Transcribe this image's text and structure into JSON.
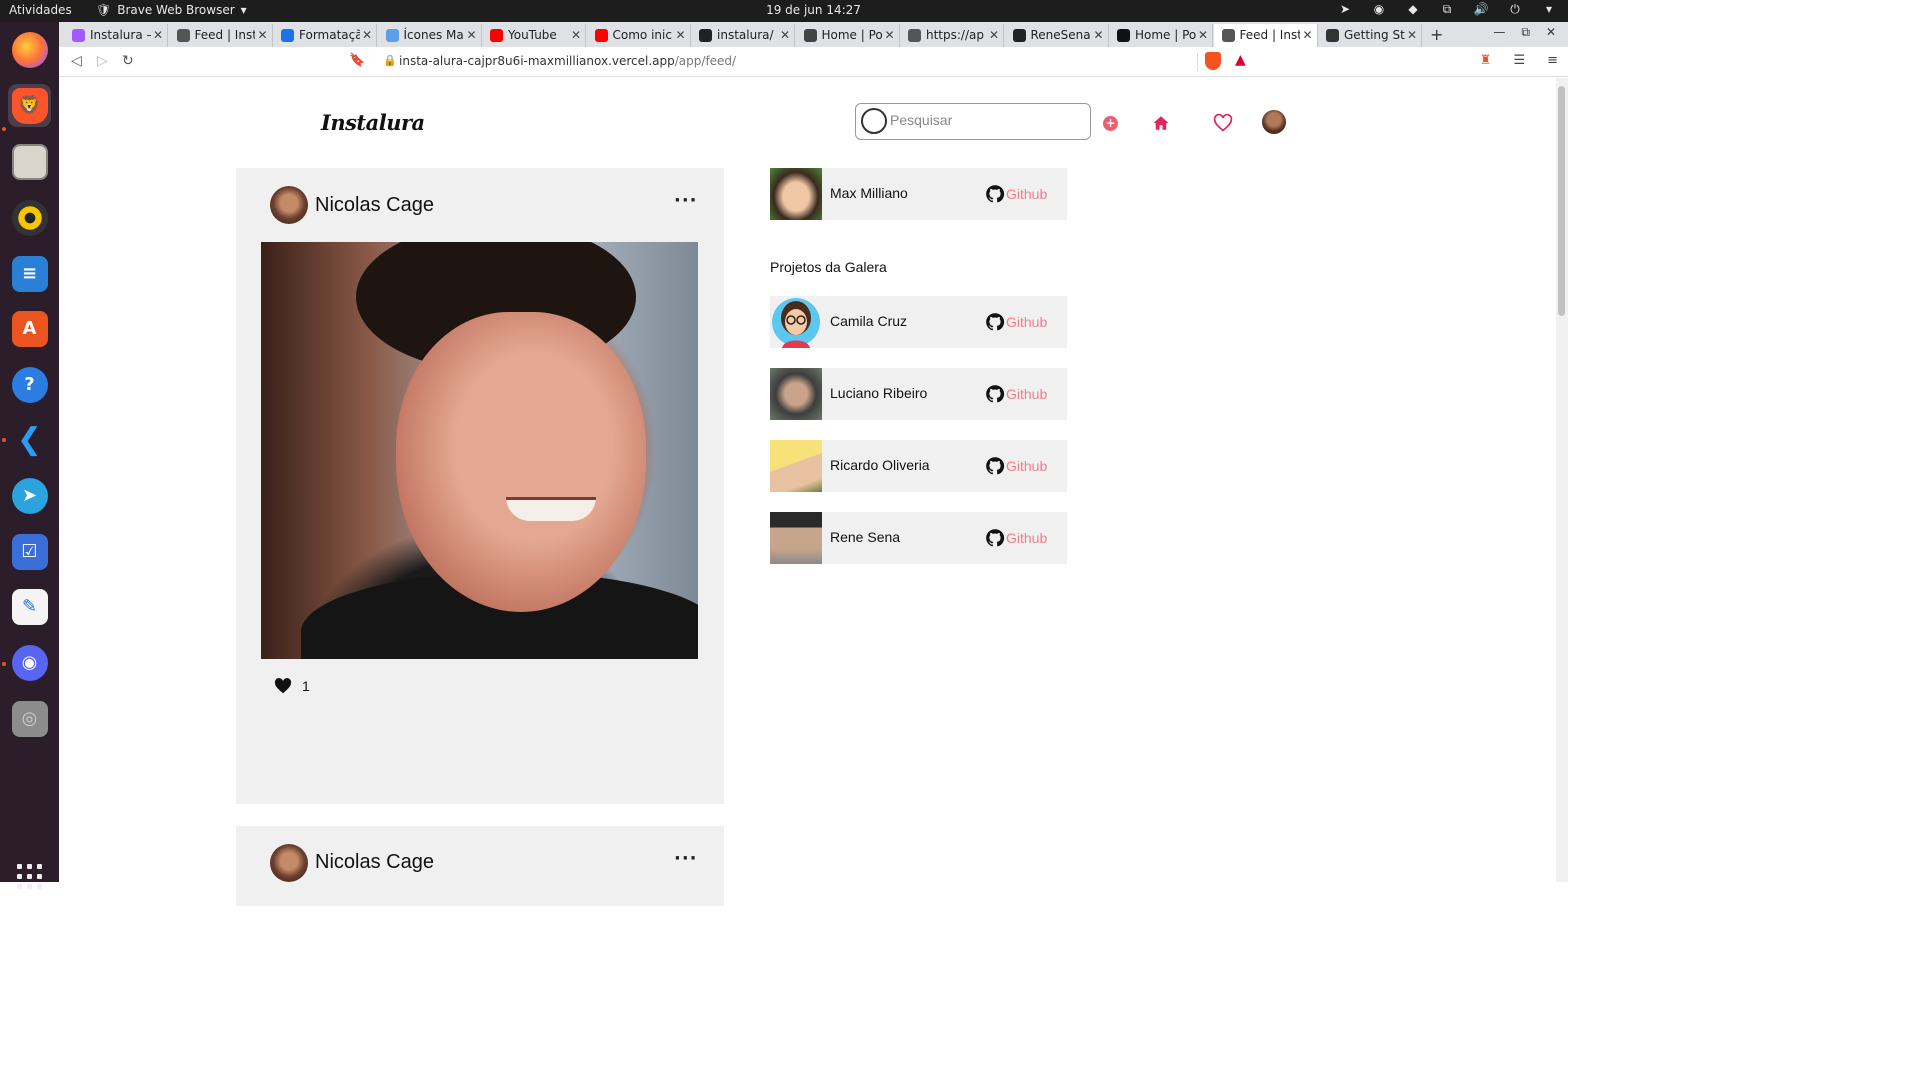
{
  "os": {
    "activities": "Atividades",
    "app_menu": "Brave Web Browser",
    "clock": "19 de jun  14:27"
  },
  "browser": {
    "tabs": [
      {
        "label": "Instalura –",
        "color": "#a259ff"
      },
      {
        "label": "Feed | Inst",
        "color": "#555555"
      },
      {
        "label": "Formataçã",
        "color": "#1a73e8"
      },
      {
        "label": "Ícones Ma",
        "color": "#5aa0e8"
      },
      {
        "label": "YouTube",
        "color": "#ff0000"
      },
      {
        "label": "Como inici",
        "color": "#ff0000"
      },
      {
        "label": "instalura/",
        "color": "#222222"
      },
      {
        "label": "Home | Po",
        "color": "#444444"
      },
      {
        "label": "https://ap",
        "color": "#555555"
      },
      {
        "label": "ReneSena",
        "color": "#222222"
      },
      {
        "label": "Home | Po",
        "color": "#111111"
      },
      {
        "label": "Feed | Inst",
        "color": "#555555"
      },
      {
        "label": "Getting St",
        "color": "#333333"
      }
    ],
    "active_tab": 11,
    "url_host": "insta-alura-cajpr8u6i-maxmillianox.vercel.app",
    "url_path": "/app/feed/"
  },
  "header": {
    "logo": "Instalura",
    "search_placeholder": "Pesquisar",
    "plus": "+",
    "accent": "#f05b6d"
  },
  "posts": [
    {
      "author": "Nicolas Cage",
      "menu": "···",
      "likes": "1"
    },
    {
      "author": "Nicolas Cage",
      "menu": "···"
    }
  ],
  "sidebar": {
    "current_user": {
      "name": "Max Milliano",
      "link": "Github"
    },
    "section_title": "Projetos da Galera",
    "projects": [
      {
        "name": "Camila Cruz",
        "link": "Github"
      },
      {
        "name": "Luciano Ribeiro",
        "link": "Github"
      },
      {
        "name": "Ricardo Oliveria",
        "link": "Github"
      },
      {
        "name": "Rene Sena",
        "link": "Github"
      }
    ],
    "link_color": "#f0808a"
  }
}
